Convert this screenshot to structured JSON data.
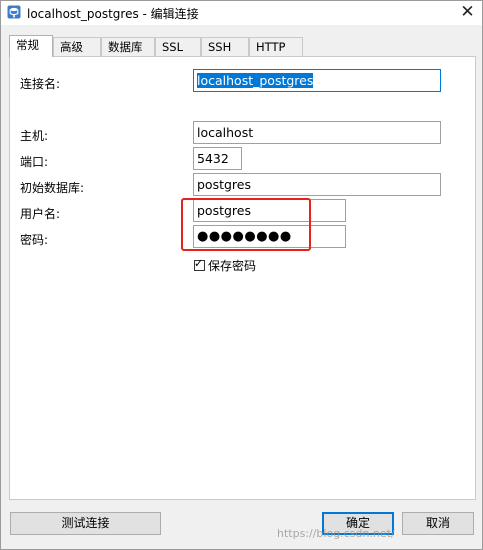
{
  "window": {
    "title": "localhost_postgres - 编辑连接",
    "icon": "database-plug-icon",
    "close_glyph": "✕"
  },
  "tabs": [
    {
      "label": "常规",
      "active": true
    },
    {
      "label": "高级",
      "active": false
    },
    {
      "label": "数据库",
      "active": false
    },
    {
      "label": "SSL",
      "active": false
    },
    {
      "label": "SSH",
      "active": false
    },
    {
      "label": "HTTP",
      "active": false
    }
  ],
  "form": {
    "connection_name": {
      "label": "连接名:",
      "value": "localhost_postgres"
    },
    "host": {
      "label": "主机:",
      "value": "localhost"
    },
    "port": {
      "label": "端口:",
      "value": "5432"
    },
    "initial_db": {
      "label": "初始数据库:",
      "value": "postgres"
    },
    "username": {
      "label": "用户名:",
      "value": "postgres"
    },
    "password": {
      "label": "密码:",
      "value": "●●●●●●●●"
    },
    "save_password": {
      "label": "保存密码",
      "checked": true
    }
  },
  "buttons": {
    "test": "测试连接",
    "ok": "确定",
    "cancel": "取消"
  },
  "watermark": "https://blog.csdn.net/",
  "colors": {
    "highlight": "#e5231b",
    "selection": "#0078d7"
  }
}
